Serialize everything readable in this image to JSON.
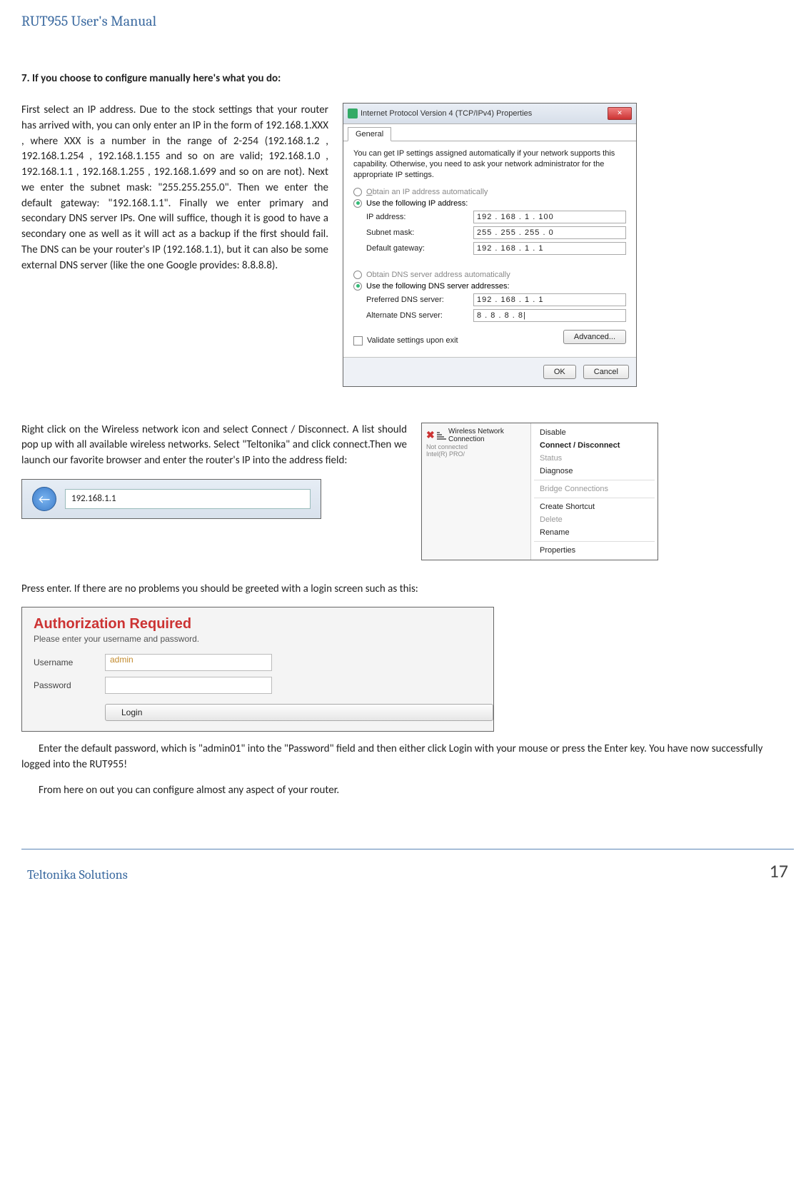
{
  "header": {
    "title": "RUT955 User's Manual"
  },
  "section": {
    "heading": "7. If you choose to configure manually here's what you do:"
  },
  "para1": "First select an IP address. Due to the stock settings that your router has arrived with, you can only enter an IP in the form of 192.168.1.XXX , where XXX is a number in the range of 2-254 (192.168.1.2 , 192.168.1.254 , 192.168.1.155 and so on are valid; 192.168.1.0 , 192.168.1.1 , 192.168.1.255 , 192.168.1.699 and so on are not). Next we enter the subnet mask: \"255.255.255.0\". Then we enter the default gateway: \"192.168.1.1\". Finally we enter primary and secondary DNS server IPs. One will suffice, though it is good to have a secondary one as well as it will act as a backup if the first should fail. The DNS can be your router's IP (192.168.1.1), but it can also be some external DNS server (like the one Google provides: 8.8.8.8).",
  "ipv4": {
    "title": "Internet Protocol Version 4 (TCP/IPv4) Properties",
    "tab": "General",
    "intro": "You can get IP settings assigned automatically if your network supports this capability. Otherwise, you need to ask your network administrator for the appropriate IP settings.",
    "radio_auto_ip": "Obtain an IP address automatically",
    "radio_use_ip": "Use the following IP address:",
    "lbl_ip": "IP address:",
    "val_ip": "192 . 168 .  1  . 100",
    "lbl_mask": "Subnet mask:",
    "val_mask": "255 . 255 . 255 .  0",
    "lbl_gw": "Default gateway:",
    "val_gw": "192 . 168 .  1  .  1",
    "radio_auto_dns": "Obtain DNS server address automatically",
    "radio_use_dns": "Use the following DNS server addresses:",
    "lbl_pdns": "Preferred DNS server:",
    "val_pdns": "192 . 168 .  1  .  1",
    "lbl_adns": "Alternate DNS server:",
    "val_adns": "  8 .  8  .  8  .  8|",
    "validate": "Validate settings upon exit",
    "advanced": "Advanced...",
    "ok": "OK",
    "cancel": "Cancel"
  },
  "para2": "Right click on the Wireless network icon and select Connect / Disconnect. A list should pop up with all available wireless networks. Select \"Teltonika\" and click connect.Then we launch our favorite browser and enter the router's IP into the address field:",
  "ctx": {
    "tray_title": "Wireless Network Connection",
    "tray_sub1": "Not connected",
    "tray_sub2": "Intel(R) PRO/",
    "items": {
      "disable": "Disable",
      "connect": "Connect / Disconnect",
      "status": "Status",
      "diagnose": "Diagnose",
      "bridge": "Bridge Connections",
      "shortcut": "Create Shortcut",
      "delete": "Delete",
      "rename": "Rename",
      "properties": "Properties"
    }
  },
  "browser": {
    "url": "192.168.1.1"
  },
  "para3": "Press enter. If there are no problems you should be greeted with a login screen such as this:",
  "login": {
    "title": "Authorization Required",
    "subtitle": "Please enter your username and password.",
    "lbl_user": "Username",
    "val_user": "admin",
    "lbl_pass": "Password",
    "btn": "Login"
  },
  "para4": "Enter the default password, which is \"admin01\" into the \"Password\" field and then either click Login with your mouse or press the Enter key. You have now successfully logged into the RUT955!",
  "para5": "From here on out you can configure almost any aspect of your router.",
  "footer": {
    "brand": "Teltonika Solutions",
    "page": "17"
  }
}
